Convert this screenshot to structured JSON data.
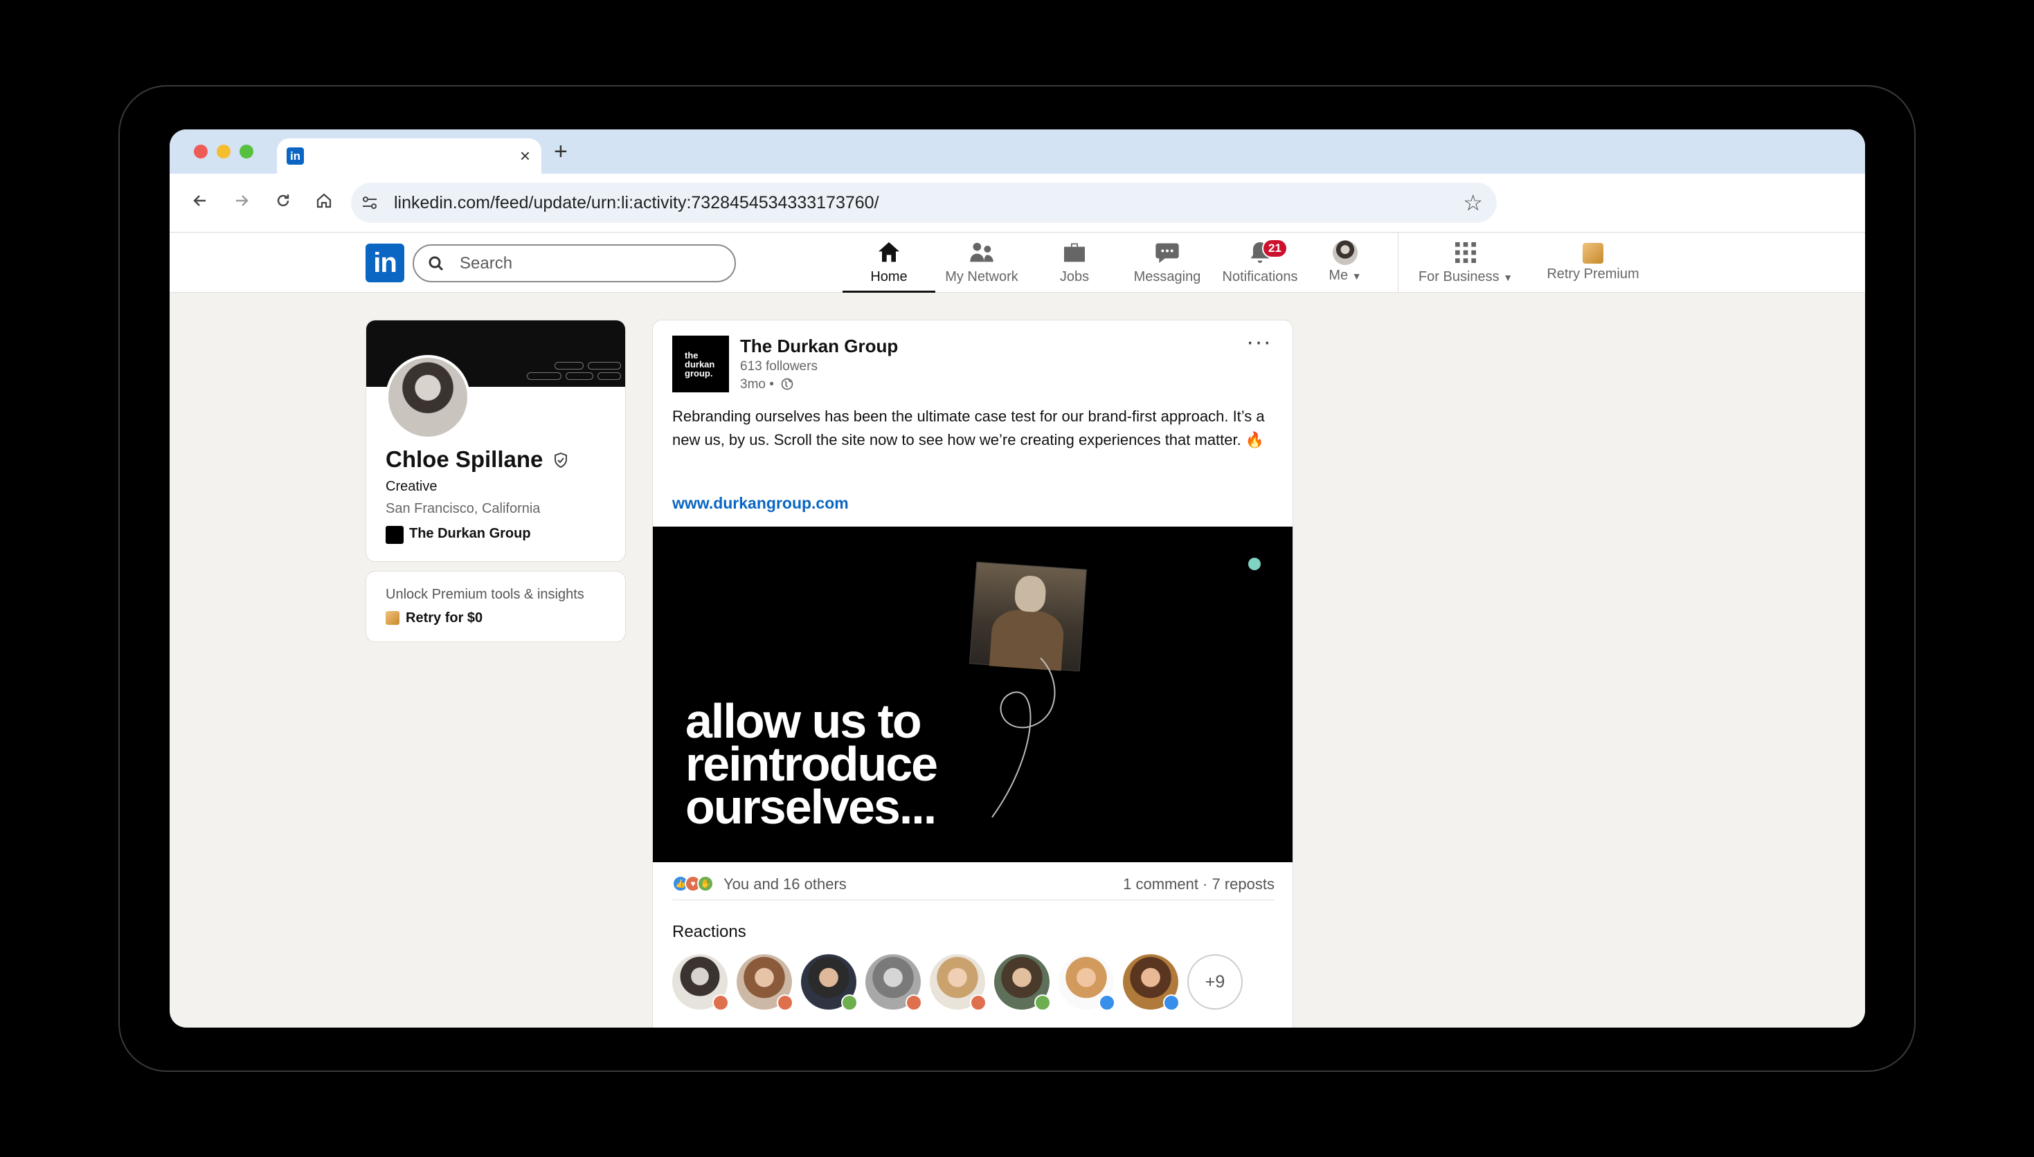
{
  "browser": {
    "tab": {
      "favicon": "linkedin-icon",
      "favicon_text": "in",
      "close": "×"
    },
    "new_tab": "+",
    "url": "linkedin.com/feed/update/urn:li:activity:7328454534333173760/"
  },
  "nav": {
    "logo_text": "in",
    "search_placeholder": "Search",
    "items": [
      {
        "label": "Home",
        "icon": "home-icon",
        "active": true
      },
      {
        "label": "My Network",
        "icon": "network-icon"
      },
      {
        "label": "Jobs",
        "icon": "briefcase-icon"
      },
      {
        "label": "Messaging",
        "icon": "messaging-icon"
      },
      {
        "label": "Notifications",
        "icon": "bell-icon",
        "badge": "21"
      },
      {
        "label": "Me",
        "icon": "avatar"
      },
      {
        "label": "For Business",
        "icon": "grid-icon"
      },
      {
        "label": "Retry Premium",
        "icon": "premium-icon"
      }
    ]
  },
  "profile": {
    "name": "Chloe Spillane",
    "role": "Creative",
    "location": "San Francisco, California",
    "organization": "The Durkan Group"
  },
  "premium": {
    "text": "Unlock Premium tools & insights",
    "cta": "Retry for $0"
  },
  "post": {
    "logo_lines": [
      "the",
      "durkan",
      "group."
    ],
    "author": "The Durkan Group",
    "followers": "613 followers",
    "time": "3mo •",
    "body": "Rebranding ourselves has been the ultimate case test for our brand-first approach. It’s a new us, by us. Scroll the site now to see how we’re creating experiences that matter. 🔥",
    "link": "www.durkangroup.com",
    "media_headline_lines": [
      "allow us to",
      "reintroduce",
      "ourselves..."
    ],
    "reactions_summary": "You and 16 others",
    "stats": "1 comment · 7 reposts",
    "reactions_title": "Reactions",
    "more_reactors": "+9",
    "reaction_colors": {
      "like": "#378fe9",
      "love": "#df704d",
      "support": "#6dae4f"
    }
  }
}
